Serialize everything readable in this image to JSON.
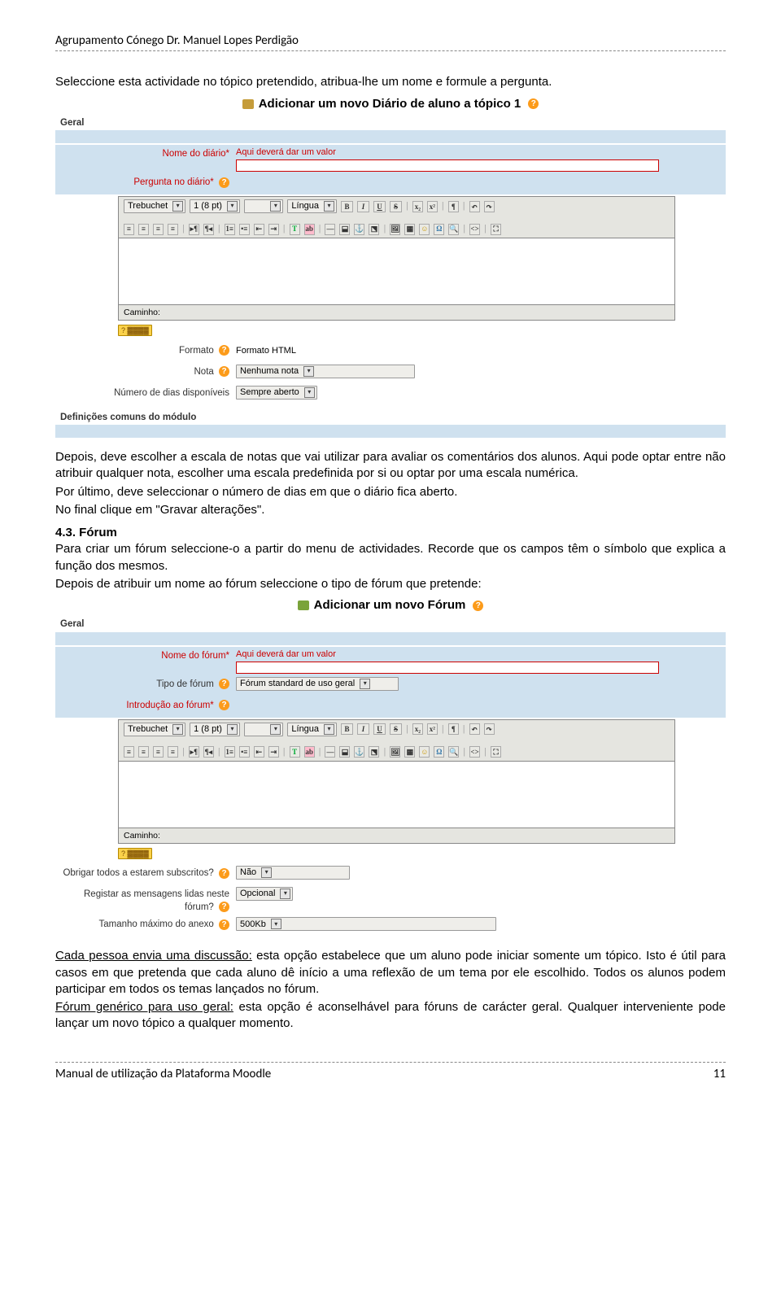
{
  "header": "Agrupamento Cónego Dr. Manuel Lopes Perdigão",
  "footer_left": "Manual de utilização da Plataforma Moodle",
  "footer_right": "11",
  "intro1": "Seleccione esta actividade no tópico pretendido, atribua-lhe um nome e formule a pergunta.",
  "after1_a": "Depois, deve escolher a escala de notas que vai utilizar para avaliar os comentários dos alunos. Aqui pode optar entre não atribuir qualquer nota, escolher uma escala predefinida por si ou optar por uma escala numérica.",
  "after1_b": "Por último, deve seleccionar o número de dias em que o diário fica aberto.",
  "after1_c": "No final clique em \"Gravar alterações\".",
  "sec43": "4.3. Fórum",
  "sec43_a": "Para criar um fórum seleccione-o a partir do menu de actividades. Recorde que os campos têm o símbolo que explica a função dos mesmos.",
  "sec43_b": "Depois de atribuir um nome ao fórum seleccione o tipo de fórum que pretende:",
  "closing_cada_heading": "Cada pessoa envia uma discussão:",
  "closing_cada_body": " esta opção estabelece que um aluno pode iniciar somente um tópico. Isto é útil para casos em que pretenda que cada aluno dê início a uma reflexão de um tema por ele escolhido. Todos os alunos podem participar em todos os temas lançados no fórum.",
  "closing_gen_heading": "Fórum genérico para uso geral:",
  "closing_gen_body": " esta opção é aconselhável para fóruns de carácter geral. Qualquer interveniente pode lançar um novo tópico a qualquer momento.",
  "shot1": {
    "title": "Adicionar um novo Diário de aluno a tópico 1",
    "geral": "Geral",
    "nome_diario_lbl": "Nome do diário*",
    "pergunta_lbl": "Pergunta no diário*",
    "req_msg": "Aqui deverá dar um valor",
    "font": "Trebuchet",
    "size": "1 (8 pt)",
    "lang": "Língua",
    "caminho": "Caminho:",
    "formato_lbl": "Formato",
    "formato_val": "Formato HTML",
    "nota_lbl": "Nota",
    "nota_val": "Nenhuma nota",
    "dias_lbl": "Número de dias disponíveis",
    "dias_val": "Sempre aberto",
    "defs": "Definições comuns do módulo"
  },
  "shot2": {
    "title": "Adicionar um novo Fórum",
    "geral": "Geral",
    "nome_lbl": "Nome do fórum*",
    "tipo_lbl": "Tipo de fórum",
    "tipo_val": "Fórum standard de uso geral",
    "intro_lbl": "Introdução ao fórum*",
    "req_msg": "Aqui deverá dar um valor",
    "font": "Trebuchet",
    "size": "1 (8 pt)",
    "lang": "Língua",
    "caminho": "Caminho:",
    "obrigar_lbl": "Obrigar todos a estarem subscritos?",
    "obrigar_val": "Não",
    "registar_lbl": "Registar as mensagens lidas neste fórum?",
    "registar_val": "Opcional",
    "anexo_lbl": "Tamanho máximo do anexo",
    "anexo_val": "500Kb"
  }
}
